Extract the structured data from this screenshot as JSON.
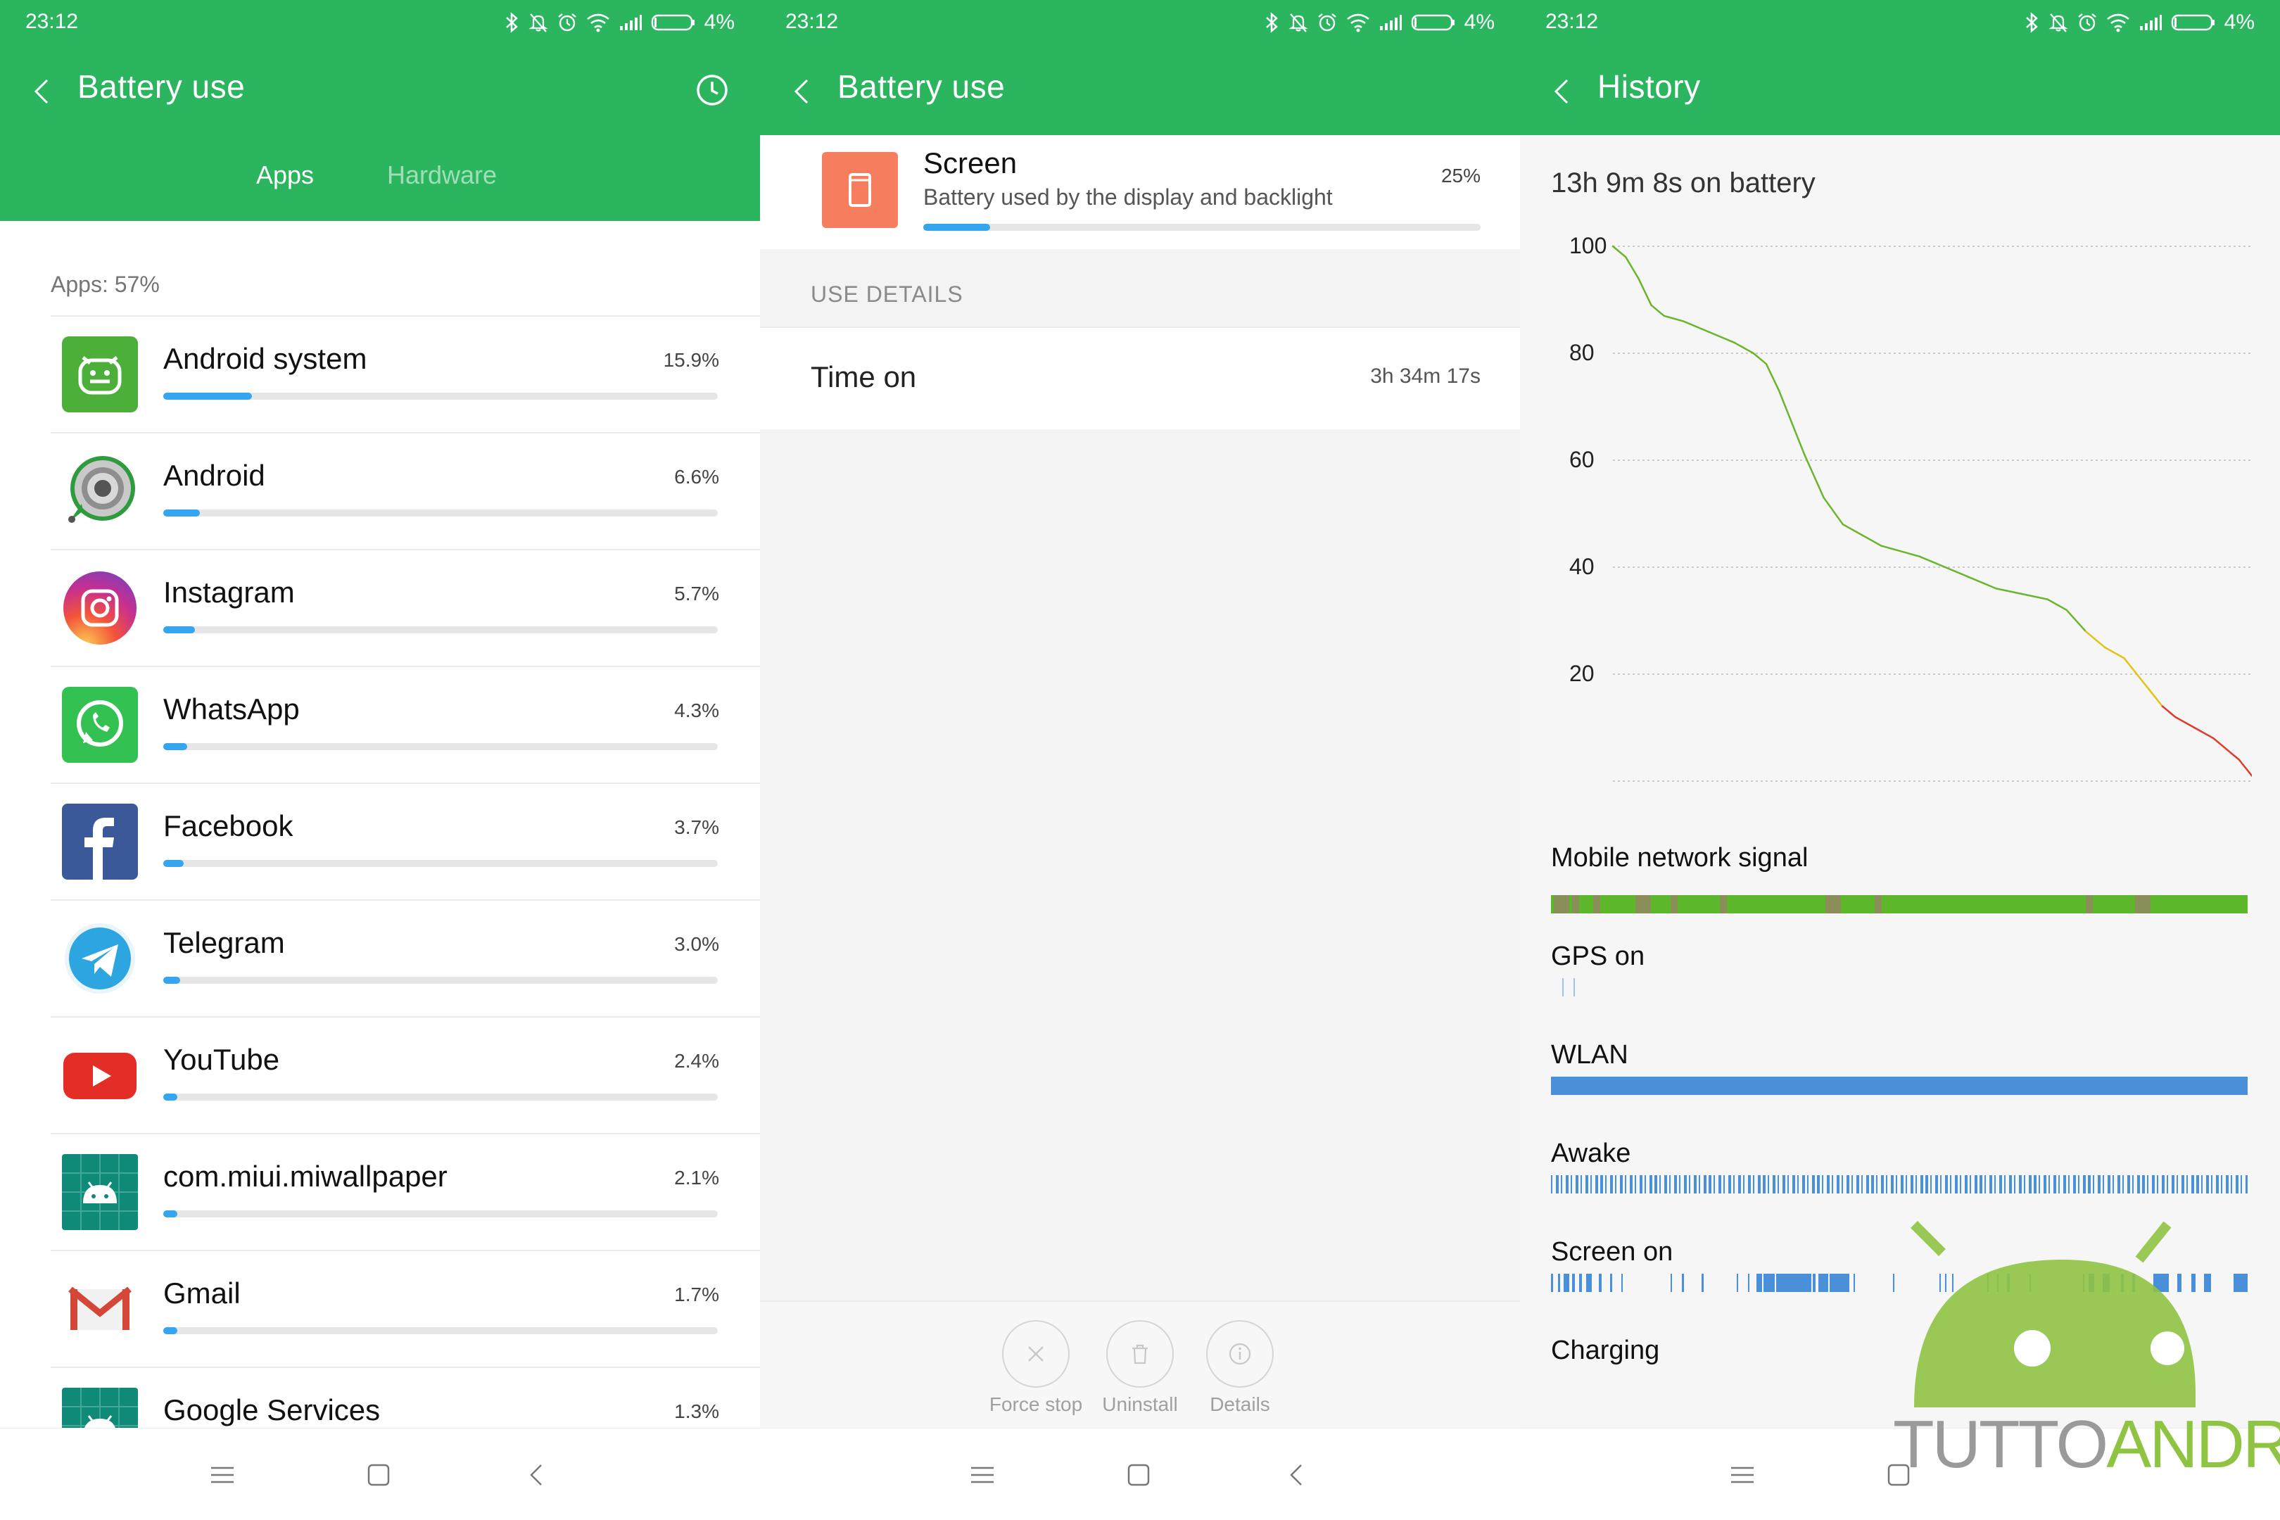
{
  "status_bar": {
    "time": "23:12",
    "battery_percent": "4%"
  },
  "colors": {
    "header_green": "#2bb55f",
    "bar_blue": "#33a6ef",
    "screen_icon_orange": "#f67e5e",
    "chart_green": "#69b62c",
    "chart_yellow": "#e0c419",
    "chart_red": "#e03a28",
    "lane_blue": "#4a90d9"
  },
  "screen1": {
    "title": "Battery use",
    "tabs": [
      {
        "label": "Apps",
        "active": true
      },
      {
        "label": "Hardware",
        "active": false
      }
    ],
    "section_label": "Apps: 57%",
    "apps": [
      {
        "name": "Android system",
        "percent": "15.9%",
        "share": 0.159,
        "icon": "android-system-icon"
      },
      {
        "name": "Android",
        "percent": "6.6%",
        "share": 0.066,
        "icon": "android-wheel-icon"
      },
      {
        "name": "Instagram",
        "percent": "5.7%",
        "share": 0.057,
        "icon": "instagram-icon"
      },
      {
        "name": "WhatsApp",
        "percent": "4.3%",
        "share": 0.043,
        "icon": "whatsapp-icon"
      },
      {
        "name": "Facebook",
        "percent": "3.7%",
        "share": 0.037,
        "icon": "facebook-icon"
      },
      {
        "name": "Telegram",
        "percent": "3.0%",
        "share": 0.03,
        "icon": "telegram-icon"
      },
      {
        "name": "YouTube",
        "percent": "2.4%",
        "share": 0.024,
        "icon": "youtube-icon"
      },
      {
        "name": "com.miui.miwallpaper",
        "percent": "2.1%",
        "share": 0.021,
        "icon": "android-generic-icon"
      },
      {
        "name": "Gmail",
        "percent": "1.7%",
        "share": 0.017,
        "icon": "gmail-icon"
      },
      {
        "name": "Google Services",
        "percent": "1.3%",
        "share": 0.013,
        "icon": "android-generic-icon"
      }
    ]
  },
  "screen2": {
    "title": "Battery use",
    "item": {
      "title": "Screen",
      "subtitle": "Battery used by the display and backlight",
      "percent": "25%",
      "share": 0.25
    },
    "section_label": "USE DETAILS",
    "detail": {
      "label": "Time on",
      "value": "3h 34m 17s"
    },
    "actions": [
      {
        "label": "Force stop"
      },
      {
        "label": "Uninstall"
      },
      {
        "label": "Details"
      }
    ]
  },
  "screen3": {
    "title": "History",
    "on_battery": "13h 9m 8s on battery",
    "signals": [
      {
        "label": "Mobile network signal"
      },
      {
        "label": "GPS on"
      },
      {
        "label": "WLAN"
      },
      {
        "label": "Awake"
      },
      {
        "label": "Screen on"
      },
      {
        "label": "Charging"
      }
    ]
  },
  "chart_data": {
    "type": "line",
    "title": "",
    "xlabel": "",
    "ylabel": "",
    "ylim": [
      0,
      100
    ],
    "y_ticks": [
      100,
      80,
      60,
      40,
      20
    ],
    "x_range": [
      0,
      1
    ],
    "grid": true,
    "series": [
      {
        "x": [
          0,
          0.02,
          0.04,
          0.06,
          0.08,
          0.11,
          0.15,
          0.19,
          0.22,
          0.24,
          0.26,
          0.28,
          0.3,
          0.33,
          0.36,
          0.39,
          0.42,
          0.45,
          0.48,
          0.52,
          0.56,
          0.6,
          0.64,
          0.68,
          0.71,
          0.74,
          0.77,
          0.8,
          0.82,
          0.84,
          0.86,
          0.88,
          0.91,
          0.94,
          0.96,
          0.98,
          1.0
        ],
        "values": [
          100,
          98,
          94,
          89,
          87,
          86,
          84,
          82,
          80,
          78,
          73,
          67,
          61,
          53,
          48,
          46,
          44,
          43,
          42,
          40,
          38,
          36,
          35,
          34,
          32,
          28,
          25,
          23,
          20,
          17,
          14,
          12,
          10,
          8,
          6,
          4,
          1
        ]
      }
    ]
  }
}
